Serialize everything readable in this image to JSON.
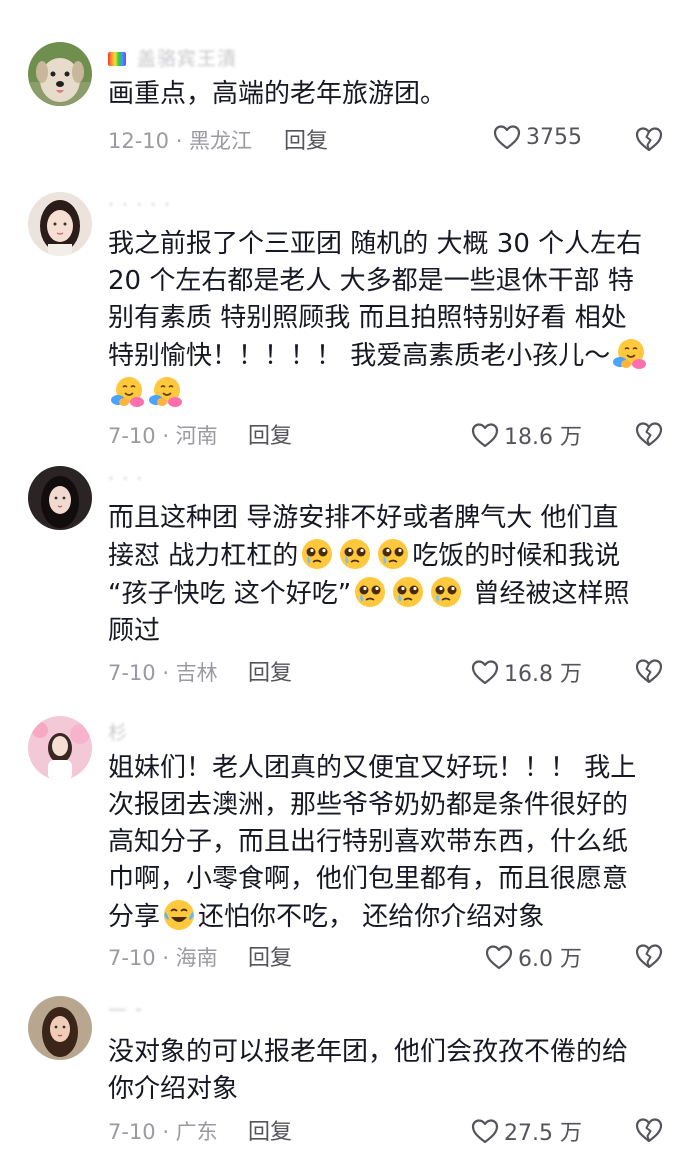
{
  "comments": [
    {
      "username": "盖骆宾王漬",
      "lines": [
        "画重点，高端的老年旅游团。"
      ],
      "date": "12-10 · 黑龙江",
      "reply": "回复",
      "likes": "3755"
    },
    {
      "username": "· · · · ·",
      "lines": [
        "我之前报了个三亚团  随机的  大概 30 个人左右",
        "20 个左右都是老人  大多都是一些退休干部  特",
        "别有素质  特别照顾我  而且拍照特别好看  相处",
        "特别愉快！！！！！  我爱高素质老小孩儿～"
      ],
      "date": "7-10 · 河南",
      "reply": "回复",
      "likes": "18.6 万"
    },
    {
      "username": "· · ·",
      "lines": [
        "而且这种团  导游安排不好或者脾气大  他们直",
        "接怼  战力杠杠的",
        "吃饭的时候和我说",
        "“孩子快吃 这个好吃”",
        "曾经被这样照",
        "顾过"
      ],
      "date": "7-10 · 吉林",
      "reply": "回复",
      "likes": "16.8 万"
    },
    {
      "username": "杉",
      "lines": [
        "姐妹们！老人团真的又便宜又好玩！！！  我上",
        "次报团去澳洲，那些爷爷奶奶都是条件很好的",
        "高知分子，而且出行特别喜欢带东西，什么纸",
        "巾啊，小零食啊，他们包里都有，而且很愿意",
        "分享",
        "还怕你不吃，  还给你介绍对象"
      ],
      "date": "7-10 · 海南",
      "reply": "回复",
      "likes": "6.0 万"
    },
    {
      "username": "— -",
      "lines": [
        "没对象的可以报老年团，他们会孜孜不倦的给",
        "你介绍对象"
      ],
      "date": "7-10 · 广东",
      "reply": "回复",
      "likes": "27.5 万"
    }
  ],
  "icons": {
    "like": "heart-outline-icon",
    "dislike": "broken-heart-icon",
    "hug": "hugging-face-emoji",
    "teary": "pleading-face-emoji",
    "laughcry": "crying-laughing-emoji",
    "rainbow": "rainbow-badge-icon"
  },
  "colors": {
    "text": "#161823",
    "meta": "#9a9aa0",
    "icon": "#54555b"
  }
}
